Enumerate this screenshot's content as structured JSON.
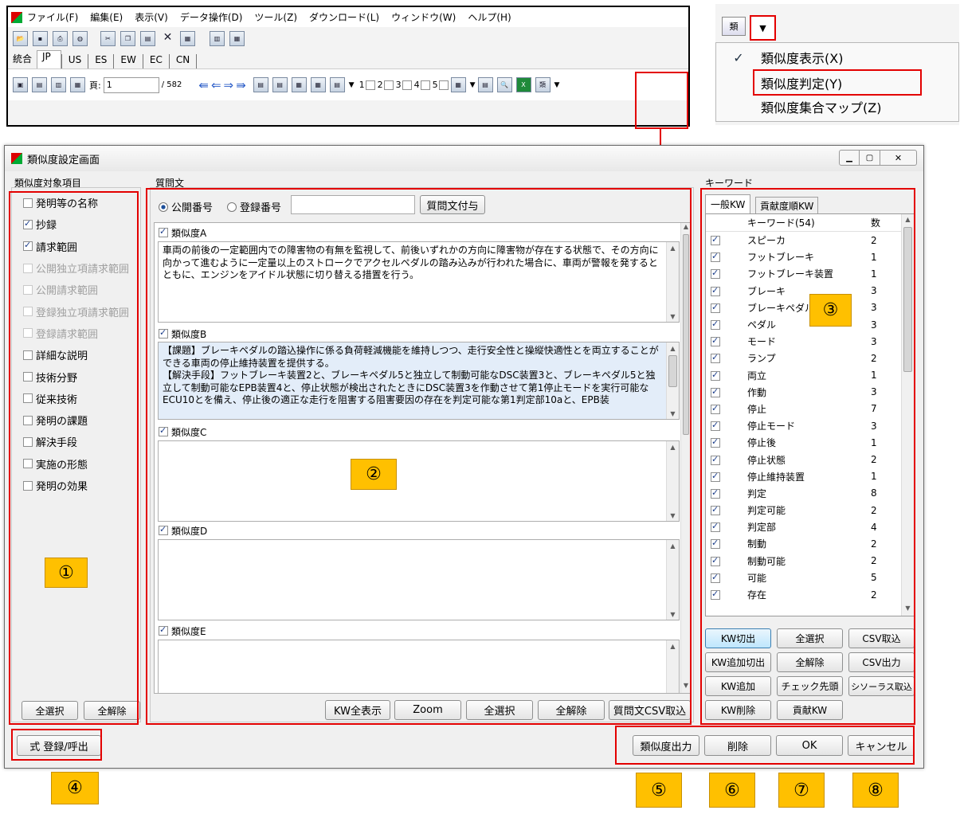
{
  "main_app": {
    "menu": [
      "ファイル(F)",
      "編集(E)",
      "表示(V)",
      "データ操作(D)",
      "ツール(Z)",
      "ダウンロード(L)",
      "ウィンドウ(W)",
      "ヘルプ(H)"
    ],
    "tabs": [
      "統合",
      "JP",
      "US",
      "ES",
      "EW",
      "EC",
      "CN"
    ],
    "active_tab": "JP",
    "page_label": "頁:",
    "page_value": "1",
    "page_total": "/ 582",
    "nums": [
      "1",
      "2",
      "3",
      "4",
      "5"
    ]
  },
  "dropdown": {
    "items": [
      {
        "label": "類似度表示(X)",
        "checked": true
      },
      {
        "label": "類似度判定(Y)",
        "checked": false
      },
      {
        "label": "類似度集合マップ(Z)",
        "checked": false
      }
    ]
  },
  "dialog": {
    "title": "類似度設定画面",
    "left_group": "類似度対象項目",
    "left_items": [
      {
        "label": "発明等の名称",
        "checked": false,
        "disabled": false
      },
      {
        "label": "抄録",
        "checked": true,
        "disabled": false
      },
      {
        "label": "請求範囲",
        "checked": true,
        "disabled": false
      },
      {
        "label": "公開独立項請求範囲",
        "checked": false,
        "disabled": true
      },
      {
        "label": "公開請求範囲",
        "checked": false,
        "disabled": true
      },
      {
        "label": "登録独立項請求範囲",
        "checked": false,
        "disabled": true
      },
      {
        "label": "登録請求範囲",
        "checked": false,
        "disabled": true
      },
      {
        "label": "詳細な説明",
        "checked": false,
        "disabled": false
      },
      {
        "label": "技術分野",
        "checked": false,
        "disabled": false
      },
      {
        "label": "従来技術",
        "checked": false,
        "disabled": false
      },
      {
        "label": "発明の課題",
        "checked": false,
        "disabled": false
      },
      {
        "label": "解決手段",
        "checked": false,
        "disabled": false
      },
      {
        "label": "実施の形態",
        "checked": false,
        "disabled": false
      },
      {
        "label": "発明の効果",
        "checked": false,
        "disabled": false
      }
    ],
    "left_buttons": [
      "全選択",
      "全解除"
    ],
    "center_group": "質問文",
    "radio_public": "公開番号",
    "radio_reg": "登録番号",
    "number_input": "",
    "add_question_button": "質問文付与",
    "questions": [
      {
        "label": "類似度A",
        "text": "車両の前後の一定範囲内での障害物の有無を監視して、前後いずれかの方向に障害物が存在する状態で、その方向に向かって進むように一定量以上のストロークでアクセルペダルの踏み込みが行われた場合に、車両が警報を発するとともに、エンジンをアイドル状態に切り替える措置を行う。"
      },
      {
        "label": "類似度B",
        "text": "【課題】ブレーキペダルの踏込操作に係る負荷軽減機能を維持しつつ、走行安全性と操縦快適性とを両立することができる車両の停止維持装置を提供する。\n【解決手段】フットブレーキ装置2と、ブレーキペダル5と独立して制動可能なDSC装置3と、ブレーキペダル5と独立して制動可能なEPB装置4と、停止状態が検出されたときにDSC装置3を作動させて第1停止モードを実行可能なECU10とを備え、停止後の適正な走行を阻害する阻害要因の存在を判定可能な第1判定部10aと、EPB装"
      },
      {
        "label": "類似度C",
        "text": ""
      },
      {
        "label": "類似度D",
        "text": ""
      },
      {
        "label": "類似度E",
        "text": ""
      }
    ],
    "center_buttons": [
      "KW全表示",
      "Zoom",
      "全選択",
      "全解除",
      "質問文CSV取込"
    ],
    "right_group": "キーワード",
    "kw_tabs": [
      "一般KW",
      "貢献度順KW"
    ],
    "kw_header_name": "キーワード(54)",
    "kw_header_count": "数",
    "keywords": [
      {
        "name": "スピーカ",
        "count": "2"
      },
      {
        "name": "フットブレーキ",
        "count": "1"
      },
      {
        "name": "フットブレーキ装置",
        "count": "1"
      },
      {
        "name": "ブレーキ",
        "count": "3"
      },
      {
        "name": "ブレーキペダル",
        "count": "3"
      },
      {
        "name": "ペダル",
        "count": "3"
      },
      {
        "name": "モード",
        "count": "3"
      },
      {
        "name": "ランプ",
        "count": "2"
      },
      {
        "name": "両立",
        "count": "1"
      },
      {
        "name": "作動",
        "count": "3"
      },
      {
        "name": "停止",
        "count": "7"
      },
      {
        "name": "停止モード",
        "count": "3"
      },
      {
        "name": "停止後",
        "count": "1"
      },
      {
        "name": "停止状態",
        "count": "2"
      },
      {
        "name": "停止維持装置",
        "count": "1"
      },
      {
        "name": "判定",
        "count": "8"
      },
      {
        "name": "判定可能",
        "count": "2"
      },
      {
        "name": "判定部",
        "count": "4"
      },
      {
        "name": "制動",
        "count": "2"
      },
      {
        "name": "制動可能",
        "count": "2"
      },
      {
        "name": "可能",
        "count": "5"
      },
      {
        "name": "存在",
        "count": "2"
      }
    ],
    "kw_buttons": [
      "KW切出",
      "全選択",
      "CSV取込",
      "KW追加切出",
      "全解除",
      "CSV出力",
      "KW追加",
      "チェック先頭",
      "シソーラス取込",
      "KW削除",
      "貢献KW"
    ],
    "formula_button": "式 登録/呼出",
    "bottom_buttons": [
      "類似度出力",
      "削除",
      "OK",
      "キャンセル"
    ]
  },
  "callouts": [
    "①",
    "②",
    "③",
    "④",
    "⑤",
    "⑥",
    "⑦",
    "⑧"
  ],
  "colors": {
    "annotation_red": "#e30000",
    "callout_yellow": "#ffc000",
    "selected_blue": "#c4dcf7"
  }
}
